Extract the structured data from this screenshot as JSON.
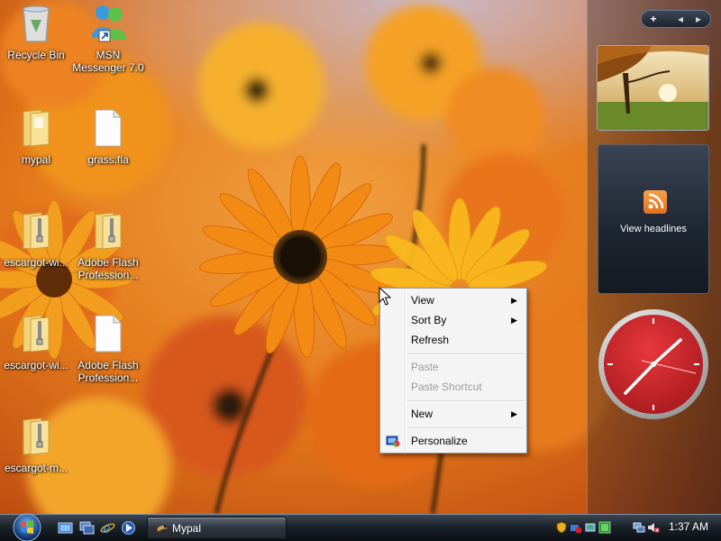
{
  "desktop": {
    "icons": [
      {
        "label": "Recycle Bin"
      },
      {
        "label": "MSN\nMessenger 7.0"
      },
      {
        "label": "mypal"
      },
      {
        "label": "grass.fla"
      },
      {
        "label": "escargot-wi..."
      },
      {
        "label": "Adobe Flash\nProfession..."
      },
      {
        "label": "escargot-wi..."
      },
      {
        "label": "Adobe Flash\nProfession..."
      },
      {
        "label": "escargot-m..."
      }
    ]
  },
  "sidebar": {
    "controls": {
      "add": "+",
      "prev": "◂",
      "next": "▸"
    },
    "feed": {
      "label": "View headlines"
    }
  },
  "context_menu": {
    "items": [
      {
        "label": "View",
        "has_submenu": true,
        "enabled": true
      },
      {
        "label": "Sort By",
        "has_submenu": true,
        "enabled": true
      },
      {
        "label": "Refresh",
        "enabled": true
      },
      {
        "label": "Paste",
        "enabled": false
      },
      {
        "label": "Paste Shortcut",
        "enabled": false
      },
      {
        "label": "New",
        "has_submenu": true,
        "enabled": true
      },
      {
        "label": "Personalize",
        "enabled": true
      }
    ],
    "submenu_arrow": "▶"
  },
  "taskbar": {
    "task_button": {
      "label": "Mypal"
    },
    "clock": "1:37 AM"
  },
  "colors": {
    "clock_face": "#d42a2e",
    "taskbar": "#1b222a",
    "menu_bg": "#f4f4f4",
    "disabled_text": "#9c9c9c"
  }
}
